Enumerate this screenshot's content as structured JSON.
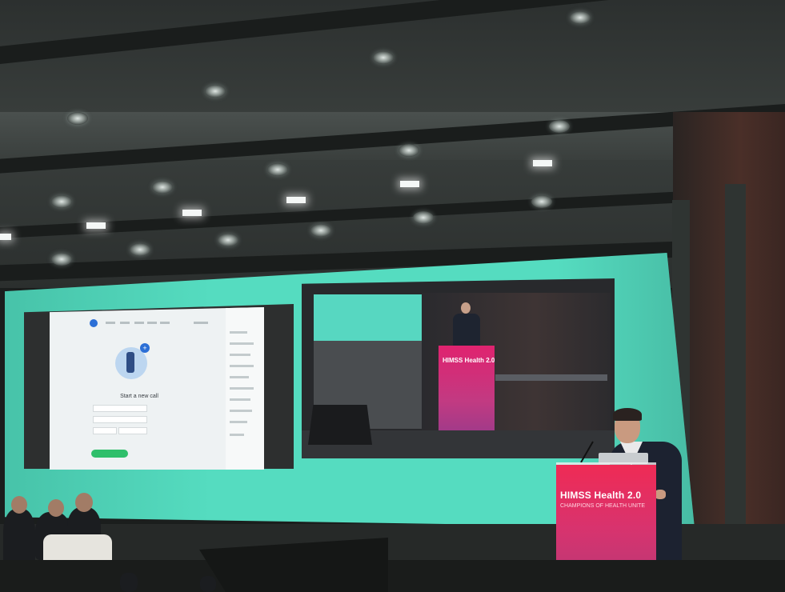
{
  "scene": {
    "podium_logo": "HIMSS  Health 2.0",
    "podium_tagline": "CHAMPIONS OF HEALTH UNITE",
    "video_podium_logo": "HIMSS Health 2.0",
    "app_slide_title": "Start a new call"
  },
  "colors": {
    "screen_teal": "#55dcc0",
    "podium_magenta": "#d8336e",
    "app_button_green": "#2fbf6b"
  }
}
